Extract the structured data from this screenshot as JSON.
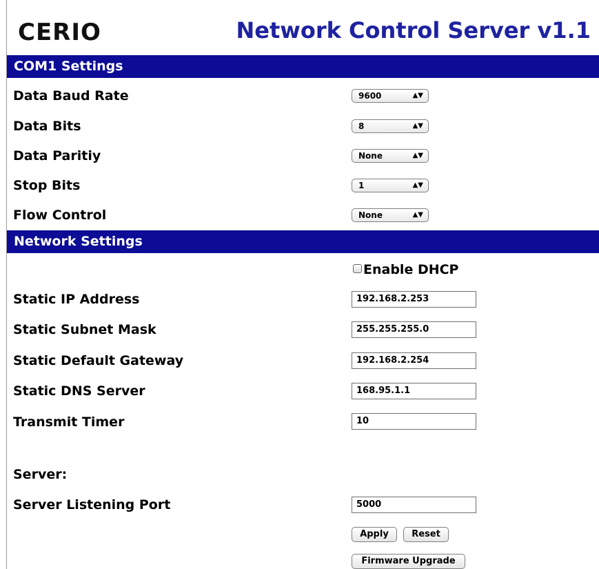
{
  "header": {
    "logo_text": "CERIO",
    "title": "Network Control Server v1.1"
  },
  "com1": {
    "section_title": "COM1 Settings",
    "baud_rate": {
      "label": "Data Baud Rate",
      "value": "9600"
    },
    "data_bits": {
      "label": "Data Bits",
      "value": "8"
    },
    "parity": {
      "label": "Data Paritiy",
      "value": "None"
    },
    "stop_bits": {
      "label": "Stop Bits",
      "value": "1"
    },
    "flow_control": {
      "label": "Flow Control",
      "value": "None"
    }
  },
  "network": {
    "section_title": "Network Settings",
    "dhcp": {
      "label": "Enable DHCP",
      "checked": false
    },
    "static_ip": {
      "label": "Static IP Address",
      "value": "192.168.2.253"
    },
    "subnet_mask": {
      "label": "Static Subnet Mask",
      "value": "255.255.255.0"
    },
    "gateway": {
      "label": "Static Default Gateway",
      "value": "192.168.2.254"
    },
    "dns": {
      "label": "Static DNS Server",
      "value": "168.95.1.1"
    },
    "transmit_timer": {
      "label": "Transmit Timer",
      "value": "10"
    }
  },
  "server": {
    "heading": "Server:",
    "listening_port": {
      "label": "Server Listening Port",
      "value": "5000"
    }
  },
  "buttons": {
    "apply": "Apply",
    "reset": "Reset",
    "firmware": "Firmware Upgrade"
  },
  "icons": {
    "select_arrow": "updown-chevron-icon"
  },
  "colors": {
    "section_bar": "#0c0c96",
    "title": "#1e22a0"
  }
}
